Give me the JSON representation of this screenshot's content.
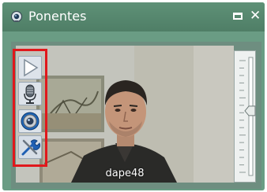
{
  "window": {
    "title": "Ponentes",
    "icons": {
      "app": "webcam-icon",
      "maximize": "maximize-icon",
      "close": "close-icon"
    },
    "close_glyph": "✕"
  },
  "video": {
    "caption": "dape48"
  },
  "toolbar": {
    "tools": [
      "play-icon",
      "microphone-icon",
      "camera-icon",
      "settings-wrench-icon"
    ],
    "highlight_color": "#e0181c"
  },
  "volume": {
    "level": 0.55
  },
  "colors": {
    "titlebar": "#5e9177",
    "frame": "#6e8e80"
  }
}
